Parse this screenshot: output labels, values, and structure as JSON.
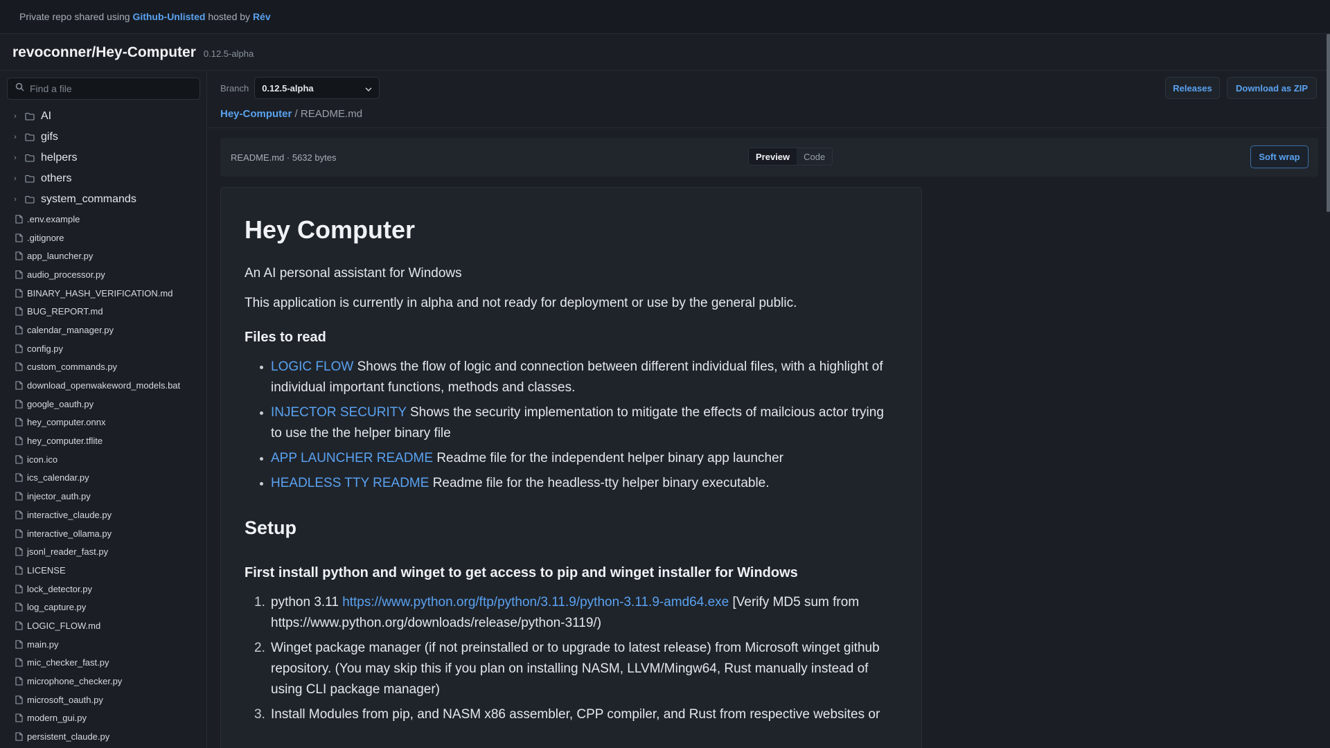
{
  "topbar": {
    "prefix": "Private repo shared using",
    "service_link": "Github-Unlisted",
    "middle": "hosted by",
    "host_link": "Rév"
  },
  "repo": {
    "title": "revoconner/Hey-Computer",
    "version": "0.12.5-alpha"
  },
  "sidebar": {
    "search_placeholder": "Find a file",
    "folders": [
      "AI",
      "gifs",
      "helpers",
      "others",
      "system_commands"
    ],
    "files": [
      ".env.example",
      ".gitignore",
      "app_launcher.py",
      "audio_processor.py",
      "BINARY_HASH_VERIFICATION.md",
      "BUG_REPORT.md",
      "calendar_manager.py",
      "config.py",
      "custom_commands.py",
      "download_openwakeword_models.bat",
      "google_oauth.py",
      "hey_computer.onnx",
      "hey_computer.tflite",
      "icon.ico",
      "ics_calendar.py",
      "injector_auth.py",
      "interactive_claude.py",
      "interactive_ollama.py",
      "jsonl_reader_fast.py",
      "LICENSE",
      "lock_detector.py",
      "log_capture.py",
      "LOGIC_FLOW.md",
      "main.py",
      "mic_checker_fast.py",
      "microphone_checker.py",
      "microsoft_oauth.py",
      "modern_gui.py",
      "persistent_claude.py"
    ]
  },
  "toolbar": {
    "branch_label": "Branch",
    "branch_value": "0.12.5-alpha",
    "releases_label": "Releases",
    "download_label": "Download as ZIP"
  },
  "breadcrumb": {
    "root": "Hey-Computer",
    "path": "/ README.md"
  },
  "file_view": {
    "meta": "README.md · 5632 bytes",
    "preview_label": "Preview",
    "code_label": "Code",
    "softwrap_label": "Soft wrap"
  },
  "readme": {
    "title": "Hey Computer",
    "subtitle": "An AI personal assistant for Windows",
    "notice": "This application is currently in alpha and not ready for deployment or use by the general public.",
    "files_heading": "Files to read",
    "files": [
      {
        "link": "LOGIC FLOW",
        "text": " Shows the flow of logic and connection between different individual files, with a highlight of individual important functions, methods and classes."
      },
      {
        "link": "INJECTOR SECURITY",
        "text": " Shows the security implementation to mitigate the effects of mailcious actor trying to use the the helper binary file"
      },
      {
        "link": "APP LAUNCHER README",
        "text": " Readme file for the independent helper binary app launcher"
      },
      {
        "link": "HEADLESS TTY README",
        "text": " Readme file for the headless-tty helper binary executable."
      }
    ],
    "setup_heading": "Setup",
    "install_heading": "First install python and winget to get access to pip and winget installer for Windows",
    "steps": [
      {
        "num": "1.",
        "prefix": "python 3.11 ",
        "link": "https://www.python.org/ftp/python/3.11.9/python-3.11.9-amd64.exe",
        "text": " [Verify MD5 sum from https://www.python.org/downloads/release/python-3119/)"
      },
      {
        "num": "2.",
        "prefix": "",
        "link": "",
        "text": "Winget package manager (if not preinstalled or to upgrade to latest release) from Microsoft winget github repository. (You may skip this if you plan on installing NASM, LLVM/Mingw64, Rust manually instead of using CLI package manager)"
      },
      {
        "num": "3.",
        "prefix": "",
        "link": "",
        "text": "Install Modules from pip, and NASM x86 assembler, CPP compiler, and Rust from respective websites or"
      }
    ]
  }
}
